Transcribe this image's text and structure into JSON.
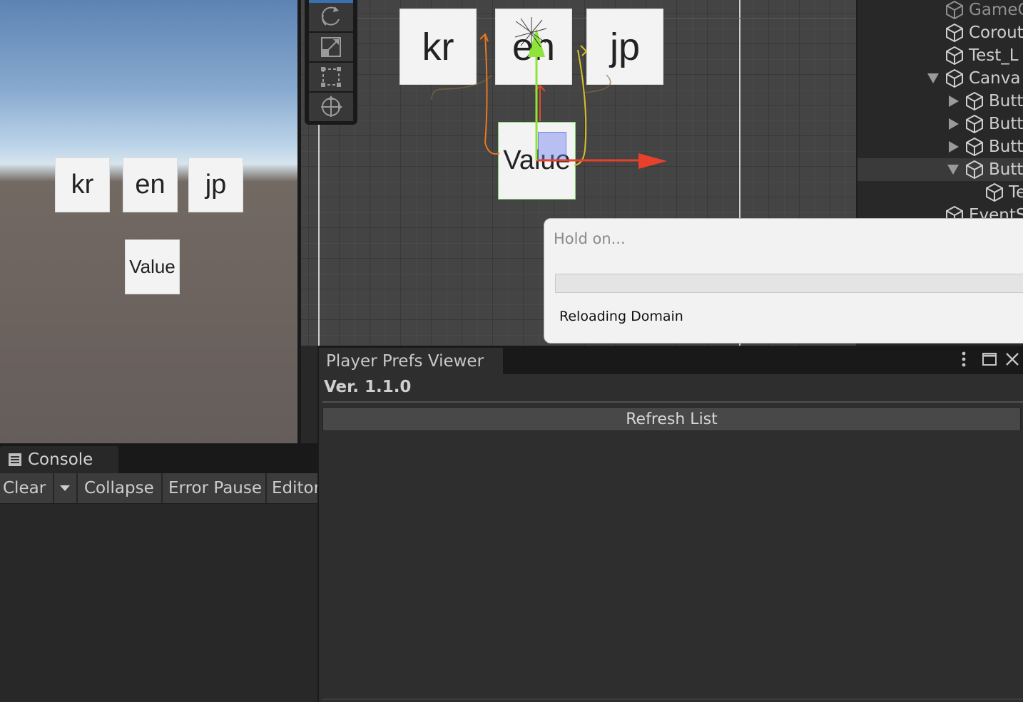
{
  "game_view": {
    "buttons": [
      "kr",
      "en",
      "jp"
    ],
    "value_label": "Value"
  },
  "scene_view": {
    "buttons": [
      "kr",
      "en",
      "jp"
    ],
    "value_label": "Value",
    "tools": [
      "rotate-tool-icon",
      "scale-tool-icon",
      "rect-tool-icon",
      "transform-tool-icon"
    ]
  },
  "hierarchy": {
    "items": [
      {
        "label": "GameC"
      },
      {
        "label": "Corout"
      },
      {
        "label": "Test_L"
      },
      {
        "label": "Canva"
      },
      {
        "label": "Butt"
      },
      {
        "label": "Butt"
      },
      {
        "label": "Butt"
      },
      {
        "label": "Butt"
      },
      {
        "label": "Te"
      },
      {
        "label": "EventS"
      }
    ]
  },
  "dialog": {
    "title": "Hold on...",
    "progress": 0,
    "message": "Reloading Domain"
  },
  "console": {
    "tab_label": "Console",
    "clear_label": "Clear",
    "collapse_label": "Collapse",
    "error_pause_label": "Error Pause",
    "editor_label": "Editor"
  },
  "player_prefs": {
    "tab_label": "Player Prefs Viewer",
    "version": "Ver. 1.1.0",
    "refresh_label": "Refresh List"
  },
  "colors": {
    "accent": "#3a72b0",
    "gizmo_x": "#e8412b",
    "gizmo_y": "#8fe33a"
  }
}
